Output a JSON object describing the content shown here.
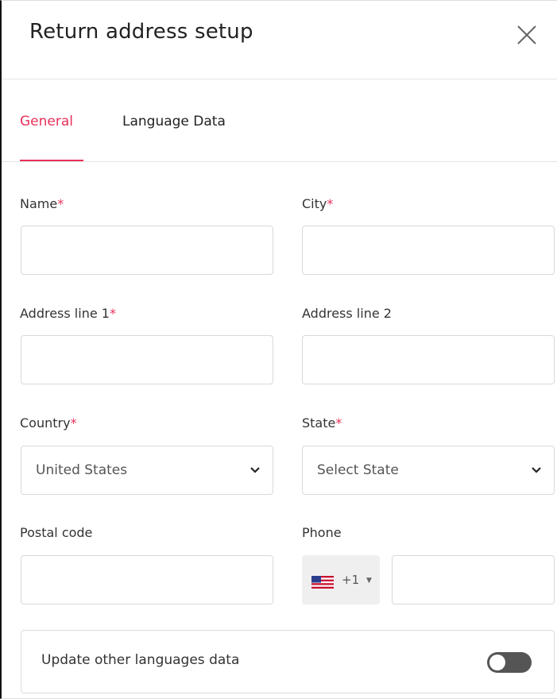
{
  "header": {
    "title": "Return address setup"
  },
  "tabs": [
    {
      "label": "General",
      "active": true
    },
    {
      "label": "Language Data",
      "active": false
    }
  ],
  "fields": {
    "name": {
      "label": "Name",
      "required": "*",
      "value": ""
    },
    "city": {
      "label": "City",
      "required": "*",
      "value": ""
    },
    "address1": {
      "label": "Address line 1",
      "required": "*",
      "value": ""
    },
    "address2": {
      "label": "Address line 2",
      "value": ""
    },
    "country": {
      "label": "Country",
      "required": "*",
      "selected": "United States"
    },
    "state": {
      "label": "State",
      "required": "*",
      "selected": "Select State"
    },
    "postal": {
      "label": "Postal code",
      "value": ""
    },
    "phone": {
      "label": "Phone",
      "dial_code": "+1",
      "value": ""
    }
  },
  "update_other_languages": {
    "label": "Update other languages data",
    "enabled": false
  },
  "colors": {
    "accent": "#e8305a",
    "toggle_off": "#555555",
    "border": "#d9d9d9"
  },
  "icons": [
    "close-icon",
    "chevron-down-icon",
    "us-flag-icon",
    "caret-down-icon"
  ]
}
